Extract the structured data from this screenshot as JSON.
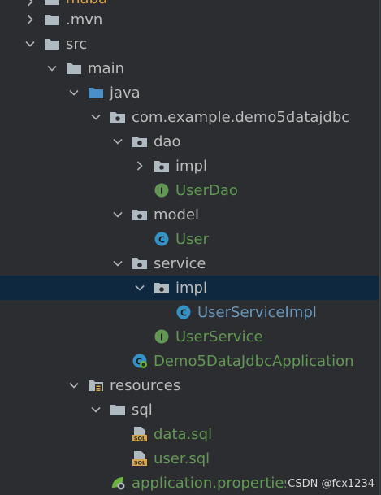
{
  "tree": {
    "items": [
      {
        "label": "maba",
        "kind": "folder",
        "expanded": false,
        "depth": 1,
        "chevron": "right",
        "partial": true
      },
      {
        "label": ".mvn",
        "kind": "folder",
        "expanded": false,
        "depth": 1,
        "chevron": "right"
      },
      {
        "label": "src",
        "kind": "folder",
        "expanded": true,
        "depth": 1,
        "chevron": "down"
      },
      {
        "label": "main",
        "kind": "folder",
        "expanded": true,
        "depth": 2,
        "chevron": "down"
      },
      {
        "label": "java",
        "kind": "source-folder",
        "expanded": true,
        "depth": 3,
        "chevron": "down"
      },
      {
        "label": "com.example.demo5datajdbc",
        "kind": "package",
        "expanded": true,
        "depth": 4,
        "chevron": "down"
      },
      {
        "label": "dao",
        "kind": "package",
        "expanded": true,
        "depth": 5,
        "chevron": "down"
      },
      {
        "label": "impl",
        "kind": "package",
        "expanded": false,
        "depth": 6,
        "chevron": "right"
      },
      {
        "label": "UserDao",
        "kind": "interface",
        "depth": 6
      },
      {
        "label": "model",
        "kind": "package",
        "expanded": true,
        "depth": 5,
        "chevron": "down"
      },
      {
        "label": "User",
        "kind": "class",
        "depth": 6
      },
      {
        "label": "service",
        "kind": "package",
        "expanded": true,
        "depth": 5,
        "chevron": "down"
      },
      {
        "label": "impl",
        "kind": "package",
        "expanded": true,
        "depth": 6,
        "chevron": "down",
        "selected": true
      },
      {
        "label": "UserServiceImpl",
        "kind": "class",
        "depth": 7
      },
      {
        "label": "UserService",
        "kind": "interface",
        "depth": 6
      },
      {
        "label": "Demo5DataJdbcApplication",
        "kind": "spring-app",
        "depth": 5
      },
      {
        "label": "resources",
        "kind": "resources-folder",
        "expanded": true,
        "depth": 3,
        "chevron": "down"
      },
      {
        "label": "sql",
        "kind": "folder",
        "expanded": true,
        "depth": 4,
        "chevron": "down"
      },
      {
        "label": "data.sql",
        "kind": "sql",
        "depth": 5
      },
      {
        "label": "user.sql",
        "kind": "sql",
        "depth": 5
      },
      {
        "label": "application.properties",
        "kind": "properties",
        "depth": 4
      }
    ]
  },
  "watermark": "CSDN @fcx1234",
  "colors": {
    "background": "#2b2d30",
    "selected_row": "#0e293f",
    "text": "#bbbbbb",
    "java_label_green": "#629755",
    "java_label_blue": "#6897bb",
    "folder_icon": "#aeb9c0",
    "class_icon": "#3592c4",
    "interface_icon": "#629755"
  }
}
